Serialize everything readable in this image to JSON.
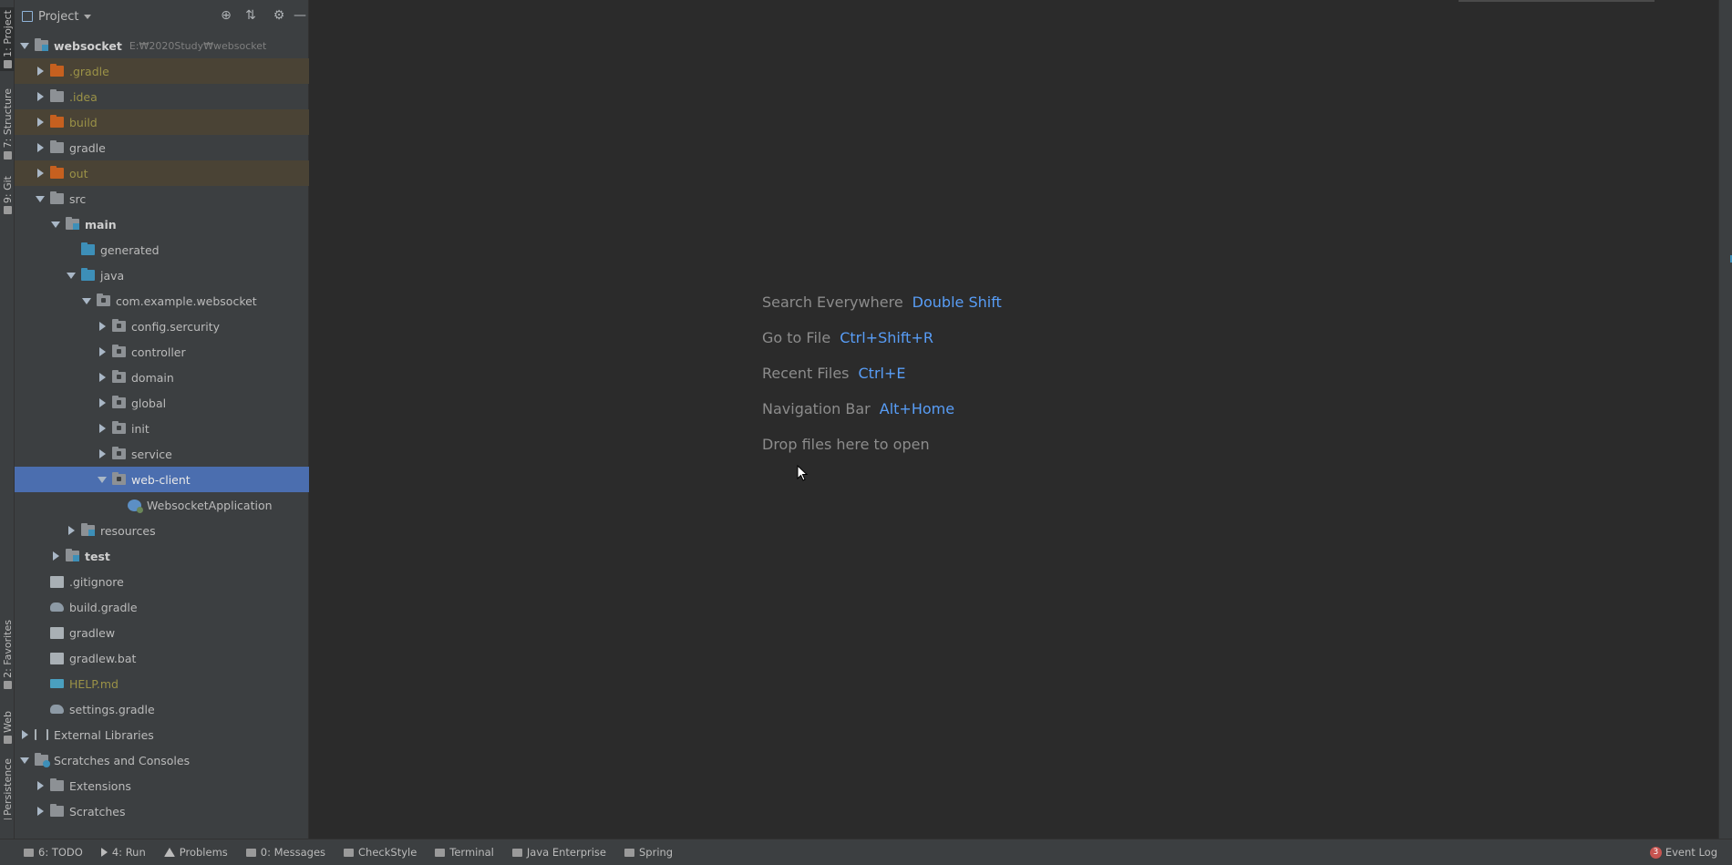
{
  "left_strip": {
    "tabs": [
      {
        "label": "1: Project",
        "icon": "folder-icon"
      },
      {
        "label": "7: Structure",
        "icon": "structure-icon"
      },
      {
        "label": "9: Git",
        "icon": "git-icon"
      },
      {
        "label": "2: Favorites",
        "icon": "star-icon"
      },
      {
        "label": "Web",
        "icon": "globe-icon"
      },
      {
        "label": "Persistence",
        "icon": "database-icon"
      }
    ]
  },
  "project_panel": {
    "title": "Project",
    "actions": {
      "locate": "⊕",
      "collapse": "⇅",
      "settings": "⚙",
      "hide": "—"
    }
  },
  "tree": [
    {
      "label": "websocket",
      "hint": "E:₩2020Study₩websocket",
      "depth": 0,
      "expand": "down",
      "icon": "src",
      "style": "bold"
    },
    {
      "label": ".gradle",
      "depth": 1,
      "expand": "right",
      "icon": "orange",
      "style": "ignored",
      "hl": true
    },
    {
      "label": ".idea",
      "depth": 1,
      "expand": "right",
      "icon": "gray",
      "style": "ignored"
    },
    {
      "label": "build",
      "depth": 1,
      "expand": "right",
      "icon": "orange",
      "style": "ignored",
      "hl": true
    },
    {
      "label": "gradle",
      "depth": 1,
      "expand": "right",
      "icon": "gray"
    },
    {
      "label": "out",
      "depth": 1,
      "expand": "right",
      "icon": "orange",
      "style": "ignored",
      "hl": true
    },
    {
      "label": "src",
      "depth": 1,
      "expand": "down",
      "icon": "gray"
    },
    {
      "label": "main",
      "depth": 2,
      "expand": "down",
      "icon": "src",
      "style": "bold"
    },
    {
      "label": "generated",
      "depth": 3,
      "expand": "none",
      "icon": "blue"
    },
    {
      "label": "java",
      "depth": 3,
      "expand": "down",
      "icon": "blue"
    },
    {
      "label": "com.example.websocket",
      "depth": 4,
      "expand": "down",
      "icon": "pkg"
    },
    {
      "label": "config.sercurity",
      "depth": 5,
      "expand": "right",
      "icon": "pkg"
    },
    {
      "label": "controller",
      "depth": 5,
      "expand": "right",
      "icon": "pkg"
    },
    {
      "label": "domain",
      "depth": 5,
      "expand": "right",
      "icon": "pkg"
    },
    {
      "label": "global",
      "depth": 5,
      "expand": "right",
      "icon": "pkg"
    },
    {
      "label": "init",
      "depth": 5,
      "expand": "right",
      "icon": "pkg"
    },
    {
      "label": "service",
      "depth": 5,
      "expand": "right",
      "icon": "pkg"
    },
    {
      "label": "web-client",
      "depth": 5,
      "expand": "down",
      "icon": "pkg",
      "selected": true
    },
    {
      "label": "WebsocketApplication",
      "depth": 6,
      "expand": "none",
      "icon": "spring"
    },
    {
      "label": "resources",
      "depth": 3,
      "expand": "right",
      "icon": "src"
    },
    {
      "label": "test",
      "depth": 2,
      "expand": "right",
      "icon": "src",
      "style": "bold"
    },
    {
      "label": ".gitignore",
      "depth": 1,
      "expand": "none",
      "icon": "file"
    },
    {
      "label": "build.gradle",
      "depth": 1,
      "expand": "none",
      "icon": "gradle"
    },
    {
      "label": "gradlew",
      "depth": 1,
      "expand": "none",
      "icon": "file"
    },
    {
      "label": "gradlew.bat",
      "depth": 1,
      "expand": "none",
      "icon": "file"
    },
    {
      "label": "HELP.md",
      "depth": 1,
      "expand": "none",
      "icon": "md",
      "style": "ignored"
    },
    {
      "label": "settings.gradle",
      "depth": 1,
      "expand": "none",
      "icon": "gradle"
    },
    {
      "label": "External Libraries",
      "depth": 0,
      "expand": "right",
      "icon": "lib"
    },
    {
      "label": "Scratches and Consoles",
      "depth": 0,
      "expand": "down",
      "icon": "scratch"
    },
    {
      "label": "Extensions",
      "depth": 1,
      "expand": "right",
      "icon": "gray"
    },
    {
      "label": "Scratches",
      "depth": 1,
      "expand": "right",
      "icon": "gray"
    }
  ],
  "editor": {
    "hints": [
      {
        "action": "Search Everywhere",
        "shortcut": "Double Shift"
      },
      {
        "action": "Go to File",
        "shortcut": "Ctrl+Shift+R"
      },
      {
        "action": "Recent Files",
        "shortcut": "Ctrl+E"
      },
      {
        "action": "Navigation Bar",
        "shortcut": "Alt+Home"
      },
      {
        "action": "Drop files here to open",
        "shortcut": ""
      }
    ]
  },
  "status_bar": {
    "items": [
      {
        "label": "6: TODO",
        "icon": "list-icon"
      },
      {
        "label": "4: Run",
        "icon": "run-icon"
      },
      {
        "label": "Problems",
        "icon": "warning-icon"
      },
      {
        "label": "0: Messages",
        "icon": "messages-icon"
      },
      {
        "label": "CheckStyle",
        "icon": "checkstyle-icon"
      },
      {
        "label": "Terminal",
        "icon": "terminal-icon"
      },
      {
        "label": "Java Enterprise",
        "icon": "java-enterprise-icon"
      },
      {
        "label": "Spring",
        "icon": "spring-icon"
      }
    ],
    "event_log": {
      "label": "Event Log",
      "count": "3"
    }
  },
  "colors": {
    "accent": "#4b6eaf",
    "link": "#589df6",
    "ignored": "#9b9247",
    "ignored_bg": "#4a4335"
  }
}
